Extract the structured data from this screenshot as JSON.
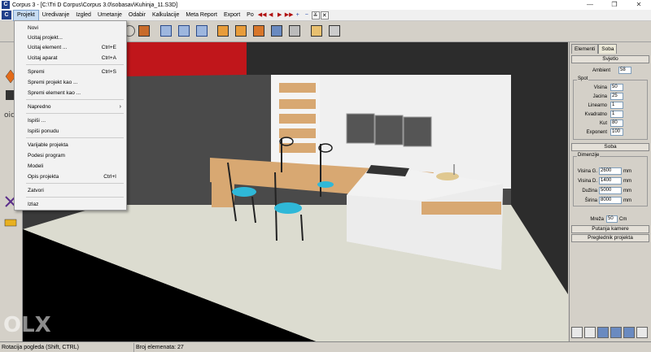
{
  "window": {
    "app_icon_letter": "C",
    "title": "Corpus 3 - [C:\\Tri D Corpus\\Corpus 3.0\\sobasav\\Kuhinja_11.S3D]",
    "minimize": "—",
    "maximize": "❐",
    "close": "✕"
  },
  "menubar": {
    "logo": "C",
    "items": [
      "Projekt",
      "Uredivanje",
      "Izgled",
      "Umetanje",
      "Odabir",
      "Kalkulacije",
      "Meta Report",
      "Export",
      "Po"
    ],
    "nav_buttons": [
      "◀◀",
      "◀",
      "▶",
      "▶▶",
      "+",
      "−",
      "≚",
      "✕"
    ]
  },
  "projekt_menu": {
    "items": [
      {
        "label": "Novi",
        "shortcut": ""
      },
      {
        "label": "Ucitaj projekt...",
        "shortcut": ""
      },
      {
        "label": "Ucitaj element ...",
        "shortcut": "Ctrl+E"
      },
      {
        "label": "Ucitaj  aparat",
        "shortcut": "Ctrl+A"
      },
      {
        "label": "Spremi",
        "shortcut": "Ctrl+S"
      },
      {
        "label": "Spremi projekt kao ...",
        "shortcut": ""
      },
      {
        "label": "Spremi element kao ...",
        "shortcut": ""
      },
      {
        "label": "Napredno",
        "shortcut": "",
        "submenu_arrow": "›"
      },
      {
        "label": "Ispiši ...",
        "shortcut": ""
      },
      {
        "label": "Ispiši ponudu",
        "shortcut": ""
      },
      {
        "label": "Varijable projekta",
        "shortcut": ""
      },
      {
        "label": "Podesi program",
        "shortcut": ""
      },
      {
        "label": "Modeli",
        "shortcut": ""
      },
      {
        "label": "Opis projekta",
        "shortcut": "Ctrl+I"
      },
      {
        "label": "Zatvori",
        "shortcut": ""
      },
      {
        "label": "Izlaz",
        "shortcut": ""
      }
    ]
  },
  "right_panel": {
    "tabs": [
      "Elementi",
      "Soba"
    ],
    "svjetlo_button": "Svjetlo",
    "ambient_label": "Ambient",
    "ambient_value": "58",
    "spot_group": "Spot",
    "spot_fields": [
      {
        "label": "Visina",
        "value": "50"
      },
      {
        "label": "Jacina",
        "value": "25"
      },
      {
        "label": "Linearno",
        "value": "1"
      },
      {
        "label": "Kvadratno",
        "value": "1"
      },
      {
        "label": "Kut",
        "value": "80"
      },
      {
        "label": "Exponent",
        "value": "100"
      }
    ],
    "soba_button": "Soba",
    "dimenzije_group": "Dimenzije",
    "dim_fields": [
      {
        "label": "Visina G.",
        "value": "2600",
        "unit": "mm"
      },
      {
        "label": "Visina D.",
        "value": "1400",
        "unit": "mm"
      },
      {
        "label": "Dužina",
        "value": "5000",
        "unit": "mm"
      },
      {
        "label": "Širina",
        "value": "8000",
        "unit": "mm"
      }
    ],
    "mreza_label": "Mreža",
    "mreza_value": "50",
    "mreza_unit": "Cm",
    "putanja_button": "Putanja kamere",
    "preglednik_button": "Preglednik projekta"
  },
  "status_bar": {
    "left": "Rotacija pogleda (Shift, CTRL)",
    "middle": "Broj elemenata: 27"
  },
  "watermark": "OLX",
  "colors": {
    "viewport_bg": "#000000",
    "red_wall": "#c0161b",
    "wood": "#d8a872",
    "counter_white": "#f2f2f2",
    "chair_seat": "#2fb8d8"
  }
}
